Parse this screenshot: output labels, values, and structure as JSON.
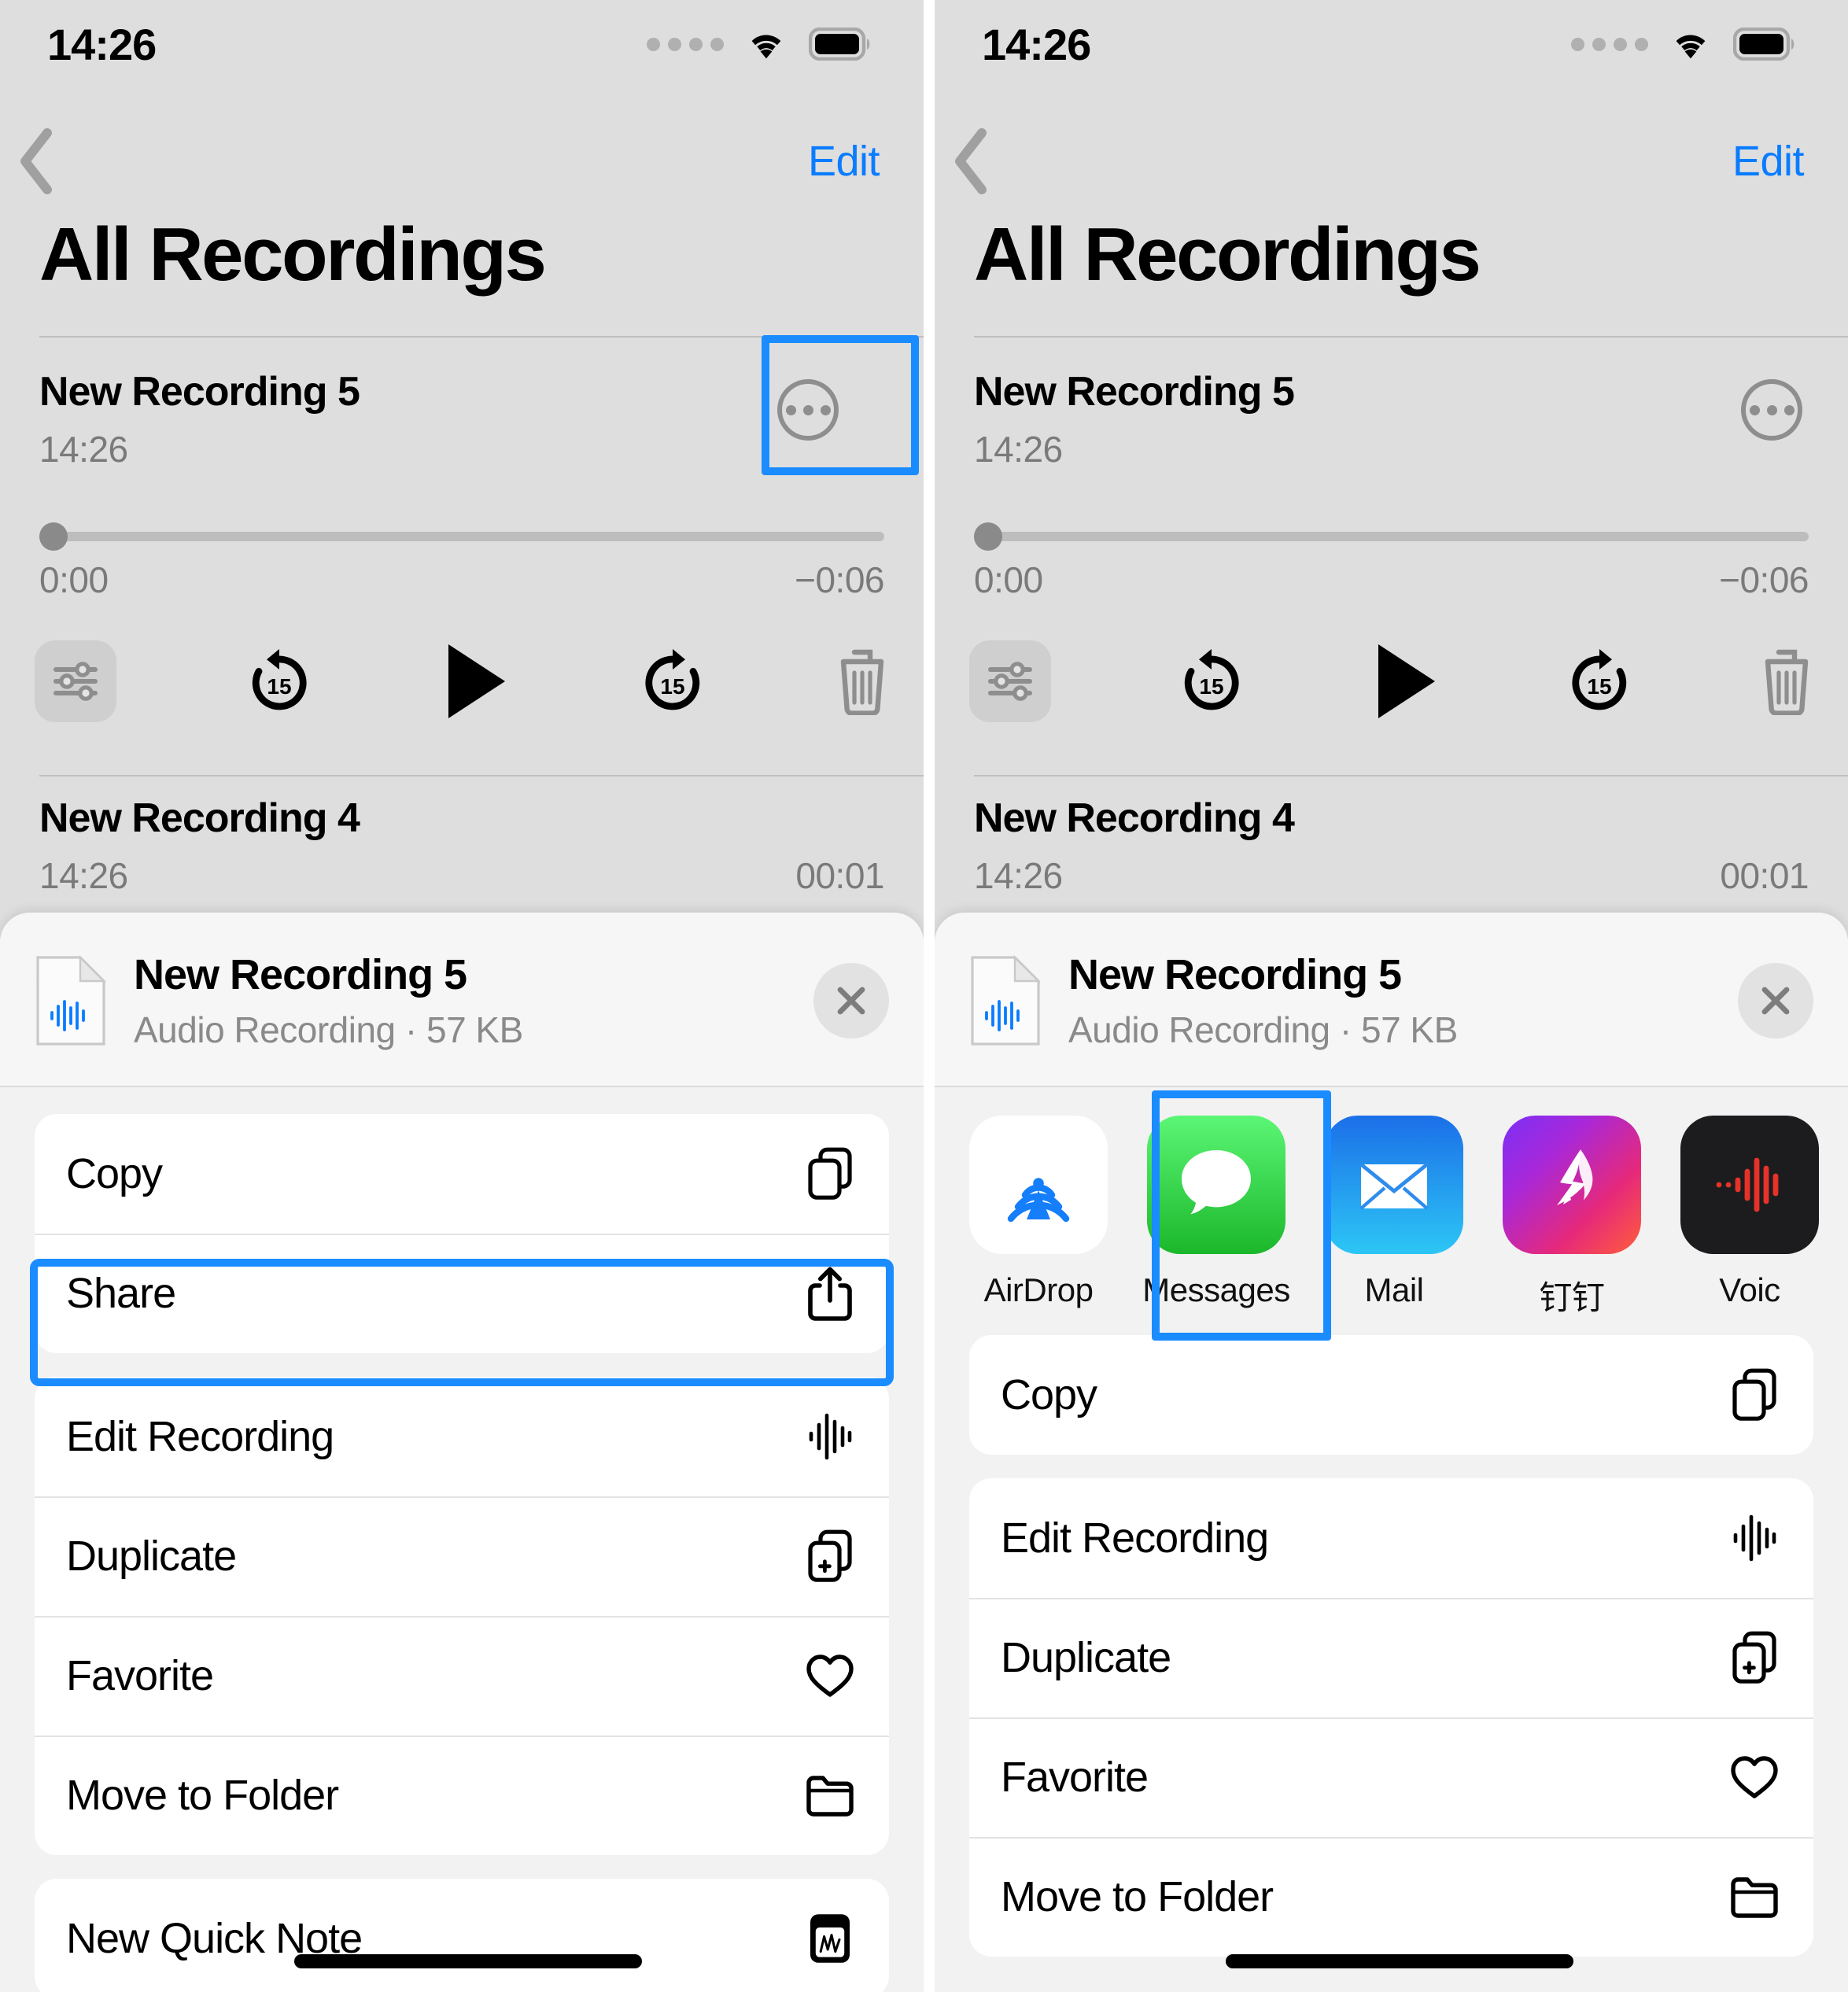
{
  "status_bar": {
    "time": "14:26",
    "signal_icon": "cellular-dots-icon",
    "wifi_icon": "wifi-icon",
    "battery_icon": "battery-full-icon"
  },
  "nav": {
    "back_icon": "chevron-left-icon",
    "edit_label": "Edit"
  },
  "page_title": "All Recordings",
  "recordings": [
    {
      "name": "New Recording 5",
      "time": "14:26",
      "duration": "",
      "more_icon": "ellipsis-circle-icon",
      "expanded": true
    },
    {
      "name": "New Recording 4",
      "time": "14:26",
      "duration": "00:01",
      "more_icon": "",
      "expanded": false
    }
  ],
  "player": {
    "elapsed": "0:00",
    "remaining": "−0:06",
    "progress_percent": 0,
    "eq_icon": "audio-settings-icon",
    "rewind_icon": "rewind-15-icon",
    "rewind_label": "15",
    "play_icon": "play-icon",
    "forward_icon": "forward-15-icon",
    "forward_label": "15",
    "delete_icon": "trash-icon"
  },
  "share_sheet": {
    "file_icon": "audio-document-icon",
    "file_title": "New Recording 5",
    "file_subtitle": "Audio Recording · 57 KB",
    "close_icon": "close-x-icon",
    "apps": [
      {
        "label": "AirDrop",
        "icon": "airdrop-icon"
      },
      {
        "label": "Messages",
        "icon": "messages-icon"
      },
      {
        "label": "Mail",
        "icon": "mail-icon"
      },
      {
        "label": "钉钉",
        "icon": "dingtalk-icon"
      },
      {
        "label": "Voic",
        "icon": "voice-memos-icon"
      }
    ],
    "menu_left": [
      {
        "label": "Copy",
        "icon": "copy-icon"
      },
      {
        "label": "Share",
        "icon": "share-icon"
      },
      {
        "label": "Edit Recording",
        "icon": "waveform-icon"
      },
      {
        "label": "Duplicate",
        "icon": "duplicate-icon"
      },
      {
        "label": "Favorite",
        "icon": "heart-icon"
      },
      {
        "label": "Move to Folder",
        "icon": "folder-icon"
      },
      {
        "label": "New Quick Note",
        "icon": "quick-note-icon"
      }
    ],
    "menu_right": [
      {
        "label": "Copy",
        "icon": "copy-icon"
      },
      {
        "label": "Edit Recording",
        "icon": "waveform-icon"
      },
      {
        "label": "Duplicate",
        "icon": "duplicate-icon"
      },
      {
        "label": "Favorite",
        "icon": "heart-icon"
      },
      {
        "label": "Move to Folder",
        "icon": "folder-icon"
      }
    ]
  },
  "colors": {
    "accent_blue": "#0a7cff",
    "highlight_blue": "#1a8cff",
    "screen_bg": "#dedede",
    "sheet_bg": "#f2f2f2",
    "card_bg": "#ffffff"
  }
}
